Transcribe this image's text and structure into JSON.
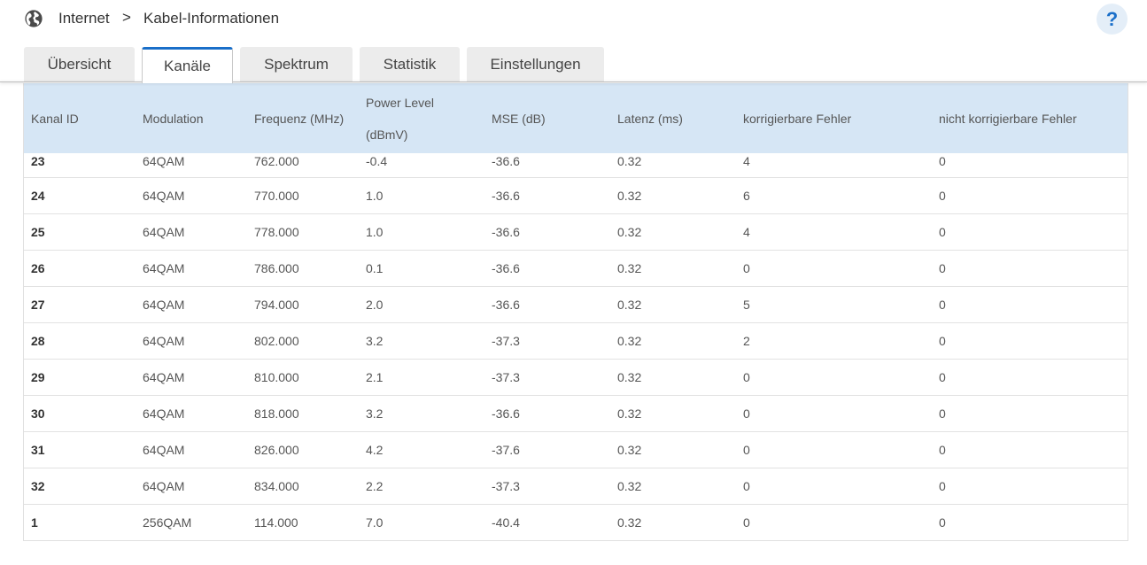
{
  "breadcrumb": {
    "section": "Internet",
    "separator": ">",
    "page": "Kabel-Informationen",
    "help_label": "?"
  },
  "tabs": [
    {
      "label": "Übersicht",
      "active": false
    },
    {
      "label": "Kanäle",
      "active": true
    },
    {
      "label": "Spektrum",
      "active": false
    },
    {
      "label": "Statistik",
      "active": false
    },
    {
      "label": "Einstellungen",
      "active": false
    }
  ],
  "colors": {
    "accent": "#1a6fc9",
    "table_header_bg": "#d6e6f5",
    "tab_bg": "#ececec"
  },
  "table": {
    "headers": {
      "kanal_id": "Kanal ID",
      "modulation": "Modulation",
      "frequenz": "Frequenz (MHz)",
      "power_level_1": "Power Level",
      "power_level_2": "(dBmV)",
      "mse": "MSE (dB)",
      "latenz": "Latenz (ms)",
      "korrigierbar": "korrigierbare Fehler",
      "nicht_korrigierbar": "nicht korrigierbare Fehler"
    },
    "rows": [
      {
        "id": "23",
        "mod": "64QAM",
        "freq": "762.000",
        "power": "-0.4",
        "mse": "-36.6",
        "lat": "0.32",
        "korr": "4",
        "nkorr": "0"
      },
      {
        "id": "24",
        "mod": "64QAM",
        "freq": "770.000",
        "power": "1.0",
        "mse": "-36.6",
        "lat": "0.32",
        "korr": "6",
        "nkorr": "0"
      },
      {
        "id": "25",
        "mod": "64QAM",
        "freq": "778.000",
        "power": "1.0",
        "mse": "-36.6",
        "lat": "0.32",
        "korr": "4",
        "nkorr": "0"
      },
      {
        "id": "26",
        "mod": "64QAM",
        "freq": "786.000",
        "power": "0.1",
        "mse": "-36.6",
        "lat": "0.32",
        "korr": "0",
        "nkorr": "0"
      },
      {
        "id": "27",
        "mod": "64QAM",
        "freq": "794.000",
        "power": "2.0",
        "mse": "-36.6",
        "lat": "0.32",
        "korr": "5",
        "nkorr": "0"
      },
      {
        "id": "28",
        "mod": "64QAM",
        "freq": "802.000",
        "power": "3.2",
        "mse": "-37.3",
        "lat": "0.32",
        "korr": "2",
        "nkorr": "0"
      },
      {
        "id": "29",
        "mod": "64QAM",
        "freq": "810.000",
        "power": "2.1",
        "mse": "-37.3",
        "lat": "0.32",
        "korr": "0",
        "nkorr": "0"
      },
      {
        "id": "30",
        "mod": "64QAM",
        "freq": "818.000",
        "power": "3.2",
        "mse": "-36.6",
        "lat": "0.32",
        "korr": "0",
        "nkorr": "0"
      },
      {
        "id": "31",
        "mod": "64QAM",
        "freq": "826.000",
        "power": "4.2",
        "mse": "-37.6",
        "lat": "0.32",
        "korr": "0",
        "nkorr": "0"
      },
      {
        "id": "32",
        "mod": "64QAM",
        "freq": "834.000",
        "power": "2.2",
        "mse": "-37.3",
        "lat": "0.32",
        "korr": "0",
        "nkorr": "0"
      },
      {
        "id": "1",
        "mod": "256QAM",
        "freq": "114.000",
        "power": "7.0",
        "mse": "-40.4",
        "lat": "0.32",
        "korr": "0",
        "nkorr": "0"
      }
    ]
  }
}
